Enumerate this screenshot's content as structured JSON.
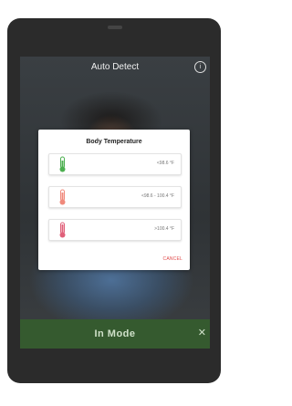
{
  "header": {
    "title": "Auto Detect",
    "info_icon": "info-icon"
  },
  "dialog": {
    "title": "Body Temperature",
    "rows": [
      {
        "value": "<98.6 °F",
        "icon": "thermometer-normal-icon",
        "color": "#4caf50"
      },
      {
        "value": "<98.6 - 100.4 °F",
        "icon": "thermometer-elevated-icon",
        "color": "#f08a7c"
      },
      {
        "value": ">100.4 °F",
        "icon": "thermometer-fever-icon",
        "color": "#e0607a"
      }
    ],
    "cancel_label": "CANCEL"
  },
  "footer": {
    "mode_label": "In Mode",
    "close_icon": "close-icon"
  }
}
